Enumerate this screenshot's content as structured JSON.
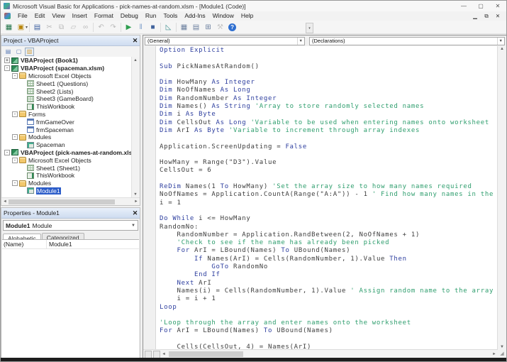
{
  "window": {
    "title": "Microsoft Visual Basic for Applications - pick-names-at-random.xlsm - [Module1 (Code)]",
    "controls": {
      "minimize": "—",
      "maximize": "▢",
      "close": "✕"
    },
    "mdi_controls": {
      "minimize": "▁",
      "restore": "⧉",
      "close": "✕"
    }
  },
  "menu": {
    "items": [
      "File",
      "Edit",
      "View",
      "Insert",
      "Format",
      "Debug",
      "Run",
      "Tools",
      "Add-Ins",
      "Window",
      "Help"
    ]
  },
  "toolbar": {
    "buttons": [
      {
        "name": "view-microsoft-excel-icon",
        "glyph": "▦",
        "color": "#1e7145"
      },
      {
        "name": "insert-userform-icon",
        "glyph": "▣",
        "color": "#b8860b",
        "dropdown": true
      },
      {
        "name": "save-icon",
        "glyph": "▤",
        "color": "#3b5fa0",
        "sep": true
      },
      {
        "name": "cut-icon",
        "glyph": "✂",
        "color": "#8a8a8a",
        "disabled": true
      },
      {
        "name": "copy-icon",
        "glyph": "⧉",
        "color": "#8a8a8a",
        "disabled": true
      },
      {
        "name": "paste-icon",
        "glyph": "▱",
        "color": "#8a8a8a",
        "disabled": true
      },
      {
        "name": "find-icon",
        "glyph": "∞",
        "color": "#8a8a8a",
        "disabled": true
      },
      {
        "name": "undo-icon",
        "glyph": "↶",
        "color": "#8a8a8a",
        "disabled": true,
        "sep": true
      },
      {
        "name": "redo-icon",
        "glyph": "↷",
        "color": "#8a8a8a",
        "disabled": true
      },
      {
        "name": "run-sub-icon",
        "glyph": "▶",
        "color": "#2e9e4f",
        "sep": true
      },
      {
        "name": "break-icon",
        "glyph": "‖",
        "color": "#7b9cc9"
      },
      {
        "name": "reset-icon",
        "glyph": "■",
        "color": "#41639c"
      },
      {
        "name": "design-mode-icon",
        "glyph": "◺",
        "color": "#3f8f8f",
        "sep": true
      },
      {
        "name": "project-explorer-icon",
        "glyph": "▦",
        "color": "#6b7f9e",
        "sep": true
      },
      {
        "name": "properties-window-icon",
        "glyph": "▤",
        "color": "#6b7f9e"
      },
      {
        "name": "object-browser-icon",
        "glyph": "⊞",
        "color": "#6b7f9e"
      },
      {
        "name": "toolbox-icon",
        "glyph": "⚒",
        "color": "#a0a0a0",
        "disabled": true
      },
      {
        "name": "help-icon",
        "glyph": "?",
        "round": true
      }
    ],
    "overflow_glyph": "▾"
  },
  "project_panel": {
    "title": "Project - VBAProject",
    "close_glyph": "✕",
    "toolbar": [
      {
        "name": "view-code-icon",
        "glyph": "▤",
        "color": "#5a7ab5"
      },
      {
        "name": "view-object-icon",
        "glyph": "▢",
        "color": "#5a7ab5"
      },
      {
        "name": "toggle-folders-icon",
        "glyph": "▨",
        "color": "#d9a440",
        "active": true
      }
    ],
    "tree": [
      {
        "label": "VBAProject (Book1)",
        "level": 0,
        "bold": true,
        "expander": "+",
        "icon": "vbaproject"
      },
      {
        "label": "VBAProject (spaceman.xlsm)",
        "level": 0,
        "bold": true,
        "expander": "-",
        "icon": "vbaproject"
      },
      {
        "label": "Microsoft Excel Objects",
        "level": 1,
        "expander": "-",
        "icon": "folder"
      },
      {
        "label": "Sheet1 (Questions)",
        "level": 2,
        "icon": "sheet"
      },
      {
        "label": "Sheet2 (Lists)",
        "level": 2,
        "icon": "sheet"
      },
      {
        "label": "Sheet3 (GameBoard)",
        "level": 2,
        "icon": "sheet"
      },
      {
        "label": "ThisWorkbook",
        "level": 2,
        "icon": "workbook"
      },
      {
        "label": "Forms",
        "level": 1,
        "expander": "-",
        "icon": "folder"
      },
      {
        "label": "frmGameOver",
        "level": 2,
        "icon": "form"
      },
      {
        "label": "frmSpaceman",
        "level": 2,
        "icon": "form"
      },
      {
        "label": "Modules",
        "level": 1,
        "expander": "-",
        "icon": "folder"
      },
      {
        "label": "Spaceman",
        "level": 2,
        "icon": "module"
      },
      {
        "label": "VBAProject (pick-names-at-random.xlsm)",
        "level": 0,
        "bold": true,
        "expander": "-",
        "icon": "vbaproject"
      },
      {
        "label": "Microsoft Excel Objects",
        "level": 1,
        "expander": "-",
        "icon": "folder"
      },
      {
        "label": "Sheet1 (Sheet1)",
        "level": 2,
        "icon": "sheet"
      },
      {
        "label": "ThisWorkbook",
        "level": 2,
        "icon": "workbook"
      },
      {
        "label": "Modules",
        "level": 1,
        "expander": "-",
        "icon": "folder"
      },
      {
        "label": "Module1",
        "level": 2,
        "icon": "module",
        "selected": true
      }
    ]
  },
  "properties_panel": {
    "title": "Properties - Module1",
    "close_glyph": "✕",
    "object_name": "Module1",
    "object_type": "Module",
    "tabs": [
      {
        "label": "Alphabetic",
        "active": true
      },
      {
        "label": "Categorized",
        "active": false
      }
    ],
    "rows": [
      {
        "name": "(Name)",
        "value": "Module1"
      }
    ]
  },
  "code_window": {
    "left_dropdown": "(General)",
    "right_dropdown": "(Declarations)",
    "lines": [
      [
        [
          "kw",
          "Option Explicit"
        ]
      ],
      [],
      [
        [
          "kw",
          "Sub"
        ],
        [
          "id",
          " PickNamesAtRandom()"
        ]
      ],
      [],
      [
        [
          "kw",
          "Dim"
        ],
        [
          "id",
          " HowMany "
        ],
        [
          "kw",
          "As Integer"
        ]
      ],
      [
        [
          "kw",
          "Dim"
        ],
        [
          "id",
          " NoOfNames "
        ],
        [
          "kw",
          "As Long"
        ]
      ],
      [
        [
          "kw",
          "Dim"
        ],
        [
          "id",
          " RandomNumber "
        ],
        [
          "kw",
          "As Integer"
        ]
      ],
      [
        [
          "kw",
          "Dim"
        ],
        [
          "id",
          " Names() "
        ],
        [
          "kw",
          "As String"
        ],
        [
          "cm",
          " 'Array to store randomly selected names"
        ]
      ],
      [
        [
          "kw",
          "Dim"
        ],
        [
          "id",
          " i "
        ],
        [
          "kw",
          "As Byte"
        ]
      ],
      [
        [
          "kw",
          "Dim"
        ],
        [
          "id",
          " CellsOut "
        ],
        [
          "kw",
          "As Long"
        ],
        [
          "cm",
          " 'Variable to be used when entering names onto worksheet"
        ]
      ],
      [
        [
          "kw",
          "Dim"
        ],
        [
          "id",
          " ArI "
        ],
        [
          "kw",
          "As Byte"
        ],
        [
          "cm",
          " 'Variable to increment through array indexes"
        ]
      ],
      [],
      [
        [
          "id",
          "Application.ScreenUpdating = "
        ],
        [
          "kw",
          "False"
        ]
      ],
      [],
      [
        [
          "id",
          "HowMany = Range(\"D3\").Value"
        ]
      ],
      [
        [
          "id",
          "CellsOut = 6"
        ]
      ],
      [],
      [
        [
          "kw",
          "ReDim"
        ],
        [
          "id",
          " Names(1 "
        ],
        [
          "kw",
          "To"
        ],
        [
          "id",
          " HowMany) "
        ],
        [
          "cm",
          "'Set the array size to how many names required"
        ]
      ],
      [
        [
          "id",
          "NoOfNames = Application.CountA(Range(\"A:A\")) - 1 "
        ],
        [
          "cm",
          "' Find how many names in the list"
        ]
      ],
      [
        [
          "id",
          "i = 1"
        ]
      ],
      [],
      [
        [
          "kw",
          "Do While"
        ],
        [
          "id",
          " i <= HowMany"
        ]
      ],
      [
        [
          "id",
          "RandomNo:"
        ]
      ],
      [
        [
          "id",
          "    RandomNumber = Application.RandBetween(2, NoOfNames + 1)"
        ]
      ],
      [
        [
          "cm",
          "    'Check to see if the name has already been picked"
        ]
      ],
      [
        [
          "id",
          "    "
        ],
        [
          "kw",
          "For"
        ],
        [
          "id",
          " ArI = LBound(Names) "
        ],
        [
          "kw",
          "To"
        ],
        [
          "id",
          " UBound(Names)"
        ]
      ],
      [
        [
          "id",
          "        "
        ],
        [
          "kw",
          "If"
        ],
        [
          "id",
          " Names(ArI) = Cells(RandomNumber, 1).Value "
        ],
        [
          "kw",
          "Then"
        ]
      ],
      [
        [
          "id",
          "            "
        ],
        [
          "kw",
          "GoTo"
        ],
        [
          "id",
          " RandomNo"
        ]
      ],
      [
        [
          "id",
          "        "
        ],
        [
          "kw",
          "End If"
        ]
      ],
      [
        [
          "id",
          "    "
        ],
        [
          "kw",
          "Next"
        ],
        [
          "id",
          " ArI"
        ]
      ],
      [
        [
          "id",
          "    Names(i) = Cells(RandomNumber, 1).Value "
        ],
        [
          "cm",
          "' Assign random name to the array"
        ]
      ],
      [
        [
          "id",
          "    i = i + 1"
        ]
      ],
      [
        [
          "kw",
          "Loop"
        ]
      ],
      [],
      [
        [
          "cm",
          "'Loop through the array and enter names onto the worksheet"
        ]
      ],
      [
        [
          "kw",
          "For"
        ],
        [
          "id",
          " ArI = LBound(Names) "
        ],
        [
          "kw",
          "To"
        ],
        [
          "id",
          " UBound(Names)"
        ]
      ],
      [],
      [
        [
          "id",
          "    Cells(CellsOut, 4) = Names(ArI)"
        ]
      ]
    ]
  },
  "colors": {
    "keyword": "#2e3f9f",
    "identifier": "#3d3d3d",
    "comment": "#2f9e6e",
    "selection": "#2b5cc9",
    "caption_top": "#e9f0fa",
    "caption_bottom": "#cedcf0"
  }
}
